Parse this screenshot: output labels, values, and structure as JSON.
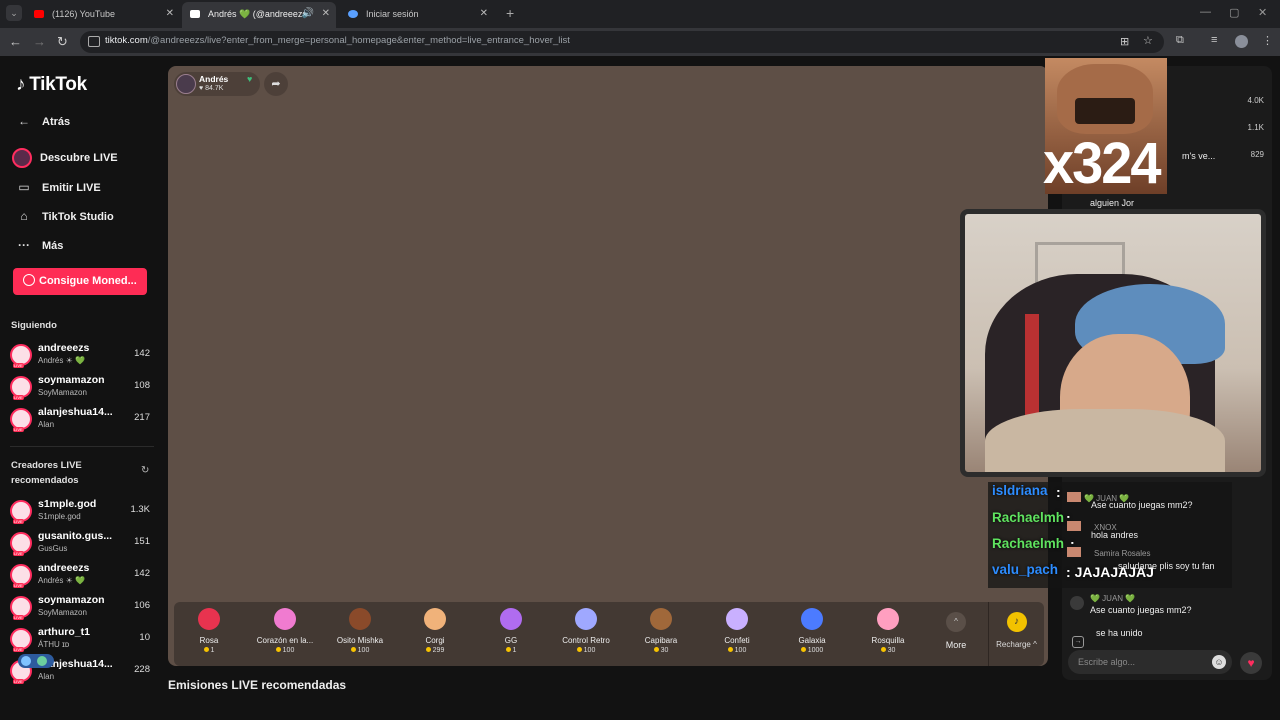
{
  "browser": {
    "tabs": [
      {
        "title": "(1126) YouTube",
        "favicon_color": "#ff0000"
      },
      {
        "title": "Andrés 💚 (@andreeezs",
        "favicon_color": "#ffffff"
      },
      {
        "title": "Iniciar sesión",
        "favicon_color": "#5aa0ff"
      }
    ],
    "url_host": "tiktok.com",
    "url_path": "/@andreeezs/live?enter_from_merge=personal_homepage&enter_method=live_entrance_hover_list"
  },
  "sidebar": {
    "logo": "TikTok",
    "back": "Atrás",
    "nav": [
      "Descubre LIVE",
      "Emitir LIVE",
      "TikTok Studio",
      "Más"
    ],
    "coins_button": "Consigue Moned...",
    "following_title": "Siguiendo",
    "following": [
      {
        "name": "andreeezs",
        "sub": "Andrés ☀ 💚",
        "count": "142"
      },
      {
        "name": "soymamazon",
        "sub": "SoyMamazon",
        "count": "108"
      },
      {
        "name": "alanjeshua14...",
        "sub": "Alan",
        "count": "217"
      }
    ],
    "recommended_title_1": "Creadores LIVE",
    "recommended_title_2": "recomendados",
    "recommended": [
      {
        "name": "s1mple.god",
        "sub": "S1mple.god",
        "count": "1.3K"
      },
      {
        "name": "gusanito.gus...",
        "sub": "GusGus",
        "count": "151"
      },
      {
        "name": "andreeezs",
        "sub": "Andrés ☀ 💚",
        "count": "142"
      },
      {
        "name": "soymamazon",
        "sub": "SoyMamazon",
        "count": "106"
      },
      {
        "name": "arthuro_t1",
        "sub": "ÁTHU ɪᴅ",
        "count": "10"
      },
      {
        "name": "alanjeshua14...",
        "sub": "Alan",
        "count": "228"
      }
    ]
  },
  "stream": {
    "host_name": "Andrés",
    "host_likes": "♥ 84.7K",
    "combo": "x324",
    "gifts": [
      {
        "name": "Rosa",
        "price": "1",
        "color": "#e8334f"
      },
      {
        "name": "Corazón en la...",
        "price": "100",
        "color": "#f07bd0"
      },
      {
        "name": "Osito Mishka",
        "price": "100",
        "color": "#8a4a2a"
      },
      {
        "name": "Corgi",
        "price": "299",
        "color": "#f0b27a"
      },
      {
        "name": "GG",
        "price": "1",
        "color": "#b06cf0"
      },
      {
        "name": "Control Retro",
        "price": "100",
        "color": "#9fa8ff"
      },
      {
        "name": "Capibara",
        "price": "30",
        "color": "#a0683a"
      },
      {
        "name": "Confeti",
        "price": "100",
        "color": "#c9b0ff"
      },
      {
        "name": "Galaxia",
        "price": "1000",
        "color": "#4c7bff"
      },
      {
        "name": "Rosquilla",
        "price": "30",
        "color": "#ff9fc0"
      }
    ],
    "more": "More",
    "recharge": "Recharge ^",
    "tts": [
      {
        "name": "isldriana",
        "color": "#2d8cff"
      },
      {
        "name": "Rachaelmh",
        "color": "#5fe35f"
      },
      {
        "name": "Rachaelmh",
        "color": "#5fe35f"
      },
      {
        "name": "valu_pach",
        "color": "#2d8cff"
      }
    ],
    "tts_tail": "JAJAJAJAJ",
    "recommended_title": "Emisiones LIVE recomendadas"
  },
  "chat": {
    "rank_values": [
      "4.0K",
      "1.1K",
      "829"
    ],
    "partial_1": "m's ve...",
    "partial_2": "alguien Jor",
    "overlay_messages": [
      {
        "user": "💚 JUAN 💚",
        "msg": "Ase cuanto juegas mm2?"
      },
      {
        "user": "XNOX",
        "msg": "hola andres"
      },
      {
        "user": "Samira Rosales",
        "msg": "saludame plis soy tu fan"
      }
    ],
    "last_user": "💚 JUAN 💚",
    "last_msg": "Ase cuanto juegas mm2?",
    "joined": "se ha unido",
    "placeholder": "Escribe algo..."
  }
}
